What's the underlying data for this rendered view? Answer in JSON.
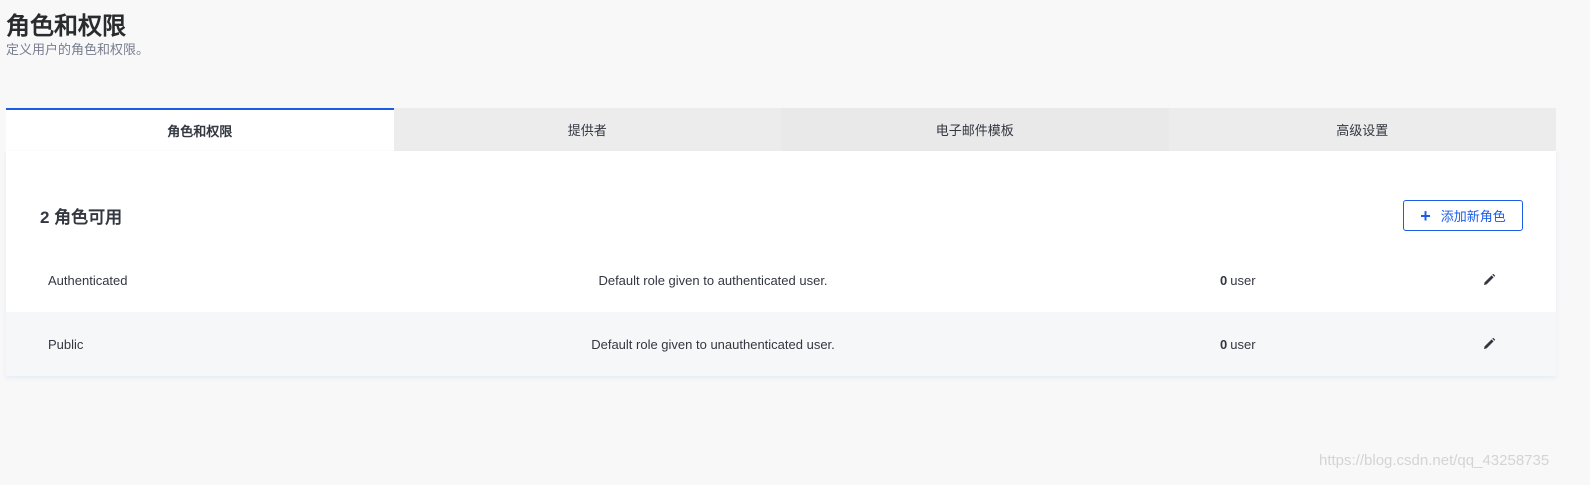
{
  "header": {
    "title": "角色和权限",
    "subtitle": "定义用户的角色和权限。"
  },
  "tabs": [
    {
      "label": "角色和权限",
      "active": true
    },
    {
      "label": "提供者",
      "active": false
    },
    {
      "label": "电子邮件模板",
      "active": false
    },
    {
      "label": "高级设置",
      "active": false
    }
  ],
  "roles_panel": {
    "count_label": "2 角色可用",
    "add_button_label": "添加新角色",
    "rows": [
      {
        "name": "Authenticated",
        "description": "Default role given to authenticated user.",
        "user_count": "0",
        "user_unit": "user"
      },
      {
        "name": "Public",
        "description": "Default role given to unauthenticated user.",
        "user_count": "0",
        "user_unit": "user"
      }
    ]
  },
  "watermark": "https://blog.csdn.net/qq_43258735",
  "colors": {
    "accent": "#1c5de7",
    "background": "#f8f8f9"
  }
}
